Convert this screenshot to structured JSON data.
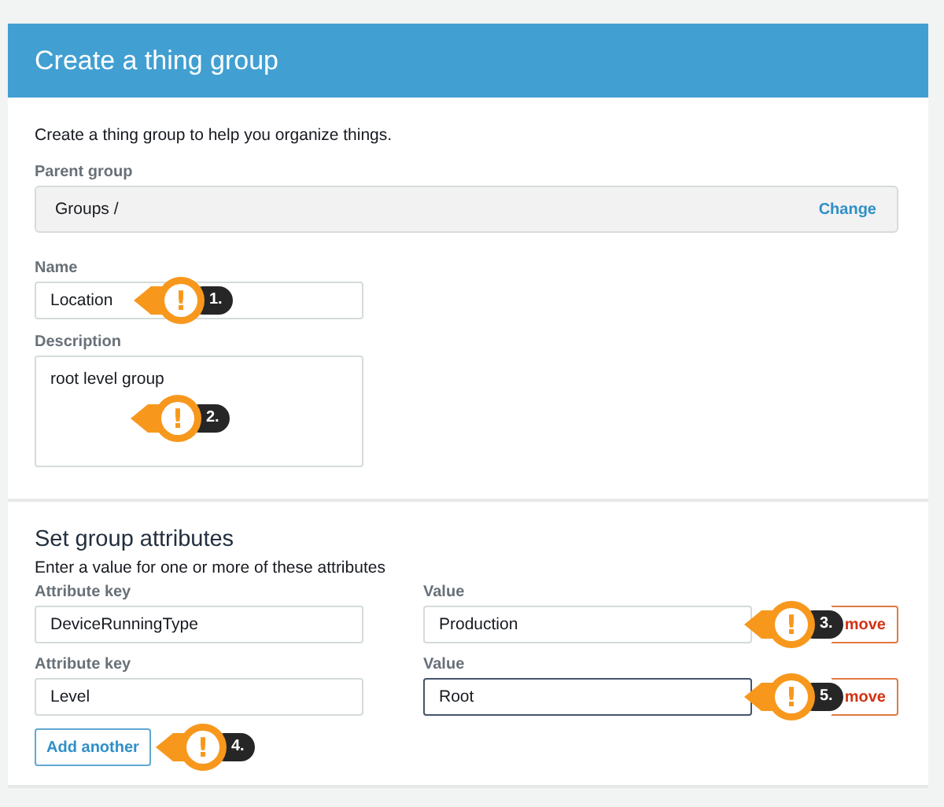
{
  "header": {
    "title": "Create a thing group"
  },
  "intro": "Create a thing group to help you organize things.",
  "parent_group": {
    "label": "Parent group",
    "value": "Groups /",
    "action": "Change"
  },
  "name": {
    "label": "Name",
    "value": "Location",
    "callout": {
      "mark": "!",
      "number": "1."
    }
  },
  "description": {
    "label": "Description",
    "value": "root level group",
    "callout": {
      "mark": "!",
      "number": "2."
    }
  },
  "attributes": {
    "title": "Set group attributes",
    "subtitle": "Enter a value for one or more of these attributes",
    "rows": [
      {
        "key_label": "Attribute key",
        "key": "DeviceRunningType",
        "value_label": "Value",
        "value": "Production",
        "focused": false,
        "remove": "move",
        "callout": {
          "mark": "!",
          "number": "3."
        }
      },
      {
        "key_label": "Attribute key",
        "key": "Level",
        "value_label": "Value",
        "value": "Root",
        "focused": true,
        "remove": "move",
        "callout": {
          "mark": "!",
          "number": "5."
        }
      }
    ],
    "add_button": {
      "label": "Add another",
      "callout": {
        "mark": "!",
        "number": "4."
      }
    }
  }
}
